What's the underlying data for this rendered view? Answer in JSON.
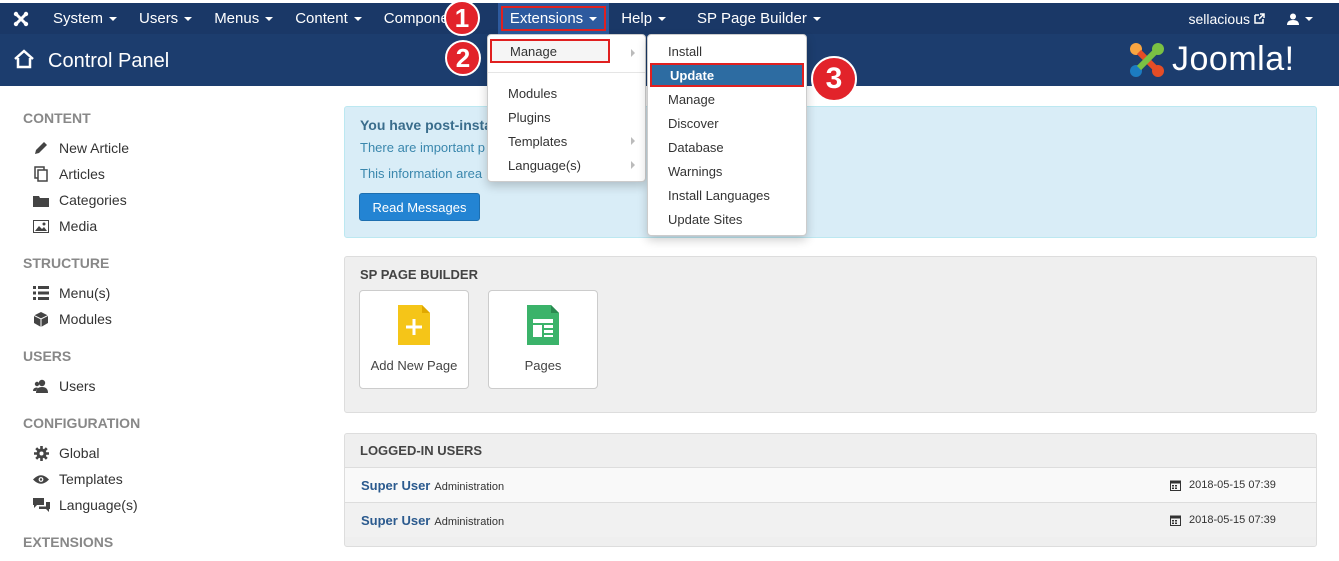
{
  "nav": {
    "items": [
      "System",
      "Users",
      "Menus",
      "Content",
      "Componer",
      "Extensions",
      "Help",
      "SP Page Builder"
    ],
    "user": "sellacious"
  },
  "header": {
    "title": "Control Panel",
    "logo": "Joomla!"
  },
  "sidebar": {
    "content_heading": "CONTENT",
    "new_article": "New Article",
    "articles": "Articles",
    "categories": "Categories",
    "media": "Media",
    "structure_heading": "STRUCTURE",
    "menus": "Menu(s)",
    "modules": "Modules",
    "users_heading": "USERS",
    "users": "Users",
    "config_heading": "CONFIGURATION",
    "global": "Global",
    "templates": "Templates",
    "languages": "Language(s)",
    "extensions_heading": "EXTENSIONS"
  },
  "alert": {
    "heading": "You have post-insta",
    "line1": "There are important p",
    "line2": "This information area",
    "button": "Read Messages"
  },
  "sp_builder": {
    "title": "SP PAGE BUILDER",
    "add_new_page": "Add New Page",
    "pages": "Pages"
  },
  "logged_in": {
    "title": "LOGGED-IN USERS",
    "rows": [
      {
        "name": "Super User",
        "role": "Administration",
        "date": "2018-05-15 07:39"
      },
      {
        "name": "Super User",
        "role": "Administration",
        "date": "2018-05-15 07:39"
      }
    ]
  },
  "extensions_menu": {
    "manage": "Manage",
    "modules": "Modules",
    "plugins": "Plugins",
    "templates": "Templates",
    "languages": "Language(s)"
  },
  "manage_submenu": {
    "items": [
      "Install",
      "Update",
      "Manage",
      "Discover",
      "Database",
      "Warnings",
      "Install Languages",
      "Update Sites"
    ]
  },
  "steps": [
    "1",
    "2",
    "3"
  ],
  "colors": {
    "navbar": "#1a3867",
    "header": "#1c3d6e",
    "accent": "#2384d3",
    "step": "#e2232a"
  }
}
